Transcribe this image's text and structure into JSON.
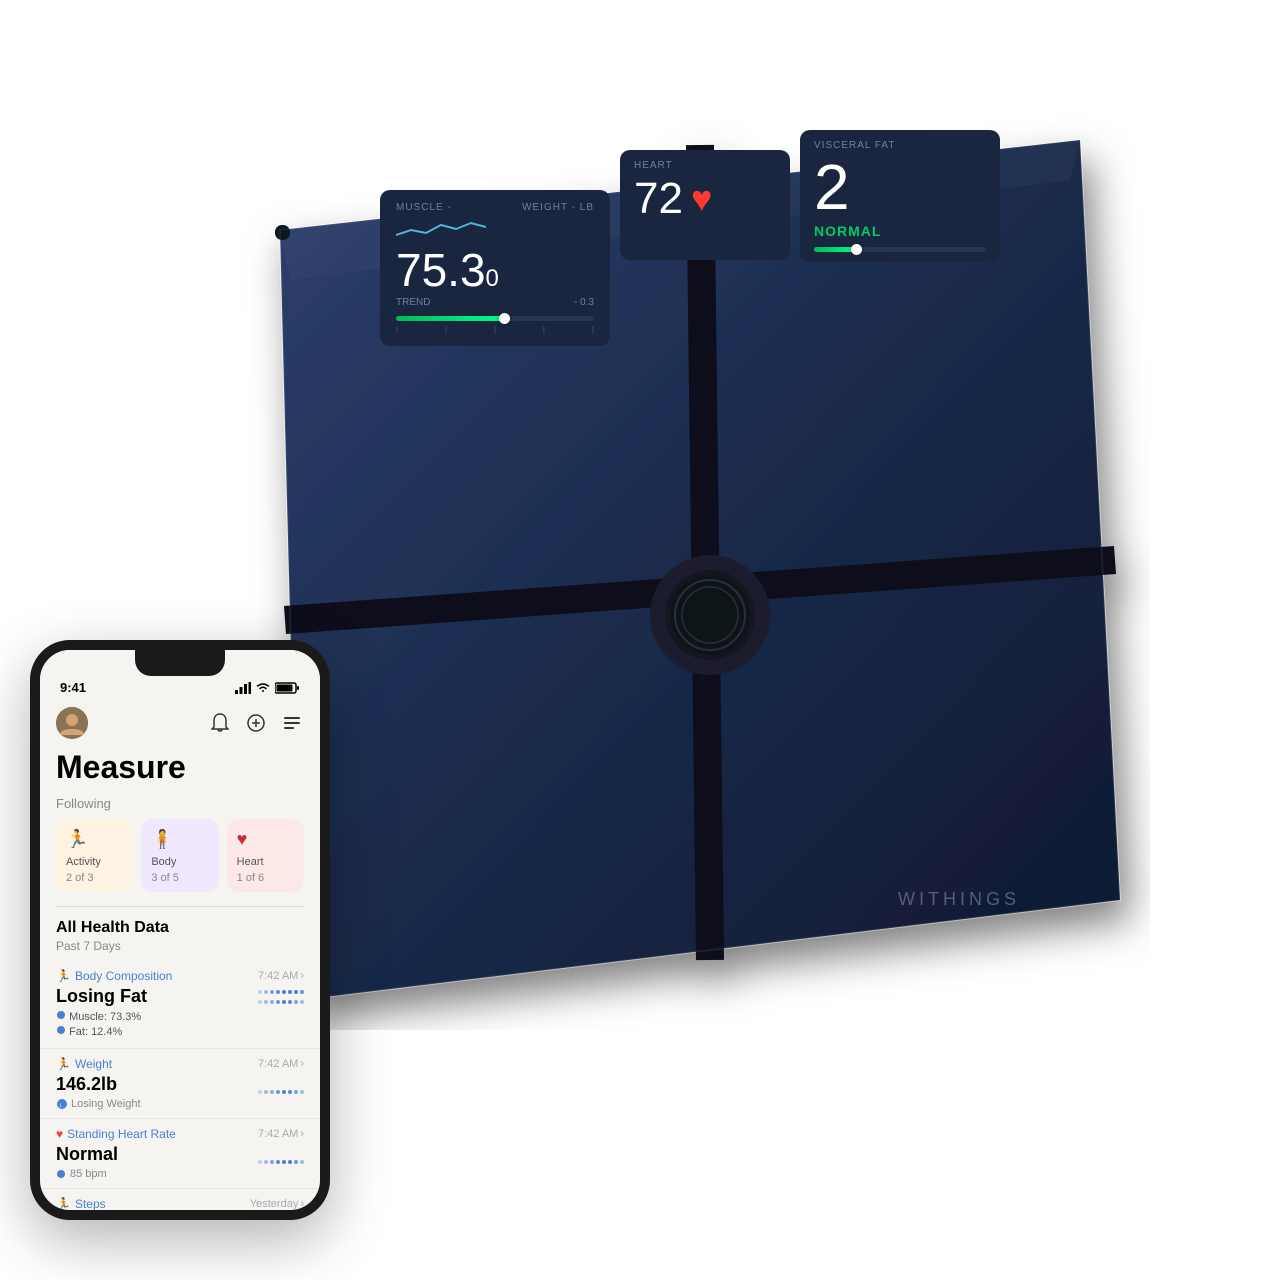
{
  "scale": {
    "brand": "WITHINGS",
    "cards": {
      "weight": {
        "label": "WEIGHT - LB",
        "muscle_label": "MUSCLE -",
        "value": "75.3",
        "value_decimal": "0",
        "trend_label": "TREND",
        "trend_value": "- 0.3",
        "progress_percent": 55
      },
      "heart": {
        "label": "HEART",
        "value": "72"
      },
      "visceral_fat": {
        "label": "VISCERAL FAT",
        "value": "2",
        "status": "NORMAL",
        "progress_percent": 25
      }
    }
  },
  "phone": {
    "status_bar": {
      "time": "9:41",
      "signal": "●●●",
      "wifi": "WiFi",
      "battery": "Battery"
    },
    "header": {
      "title": "Measure"
    },
    "following": {
      "label": "Following",
      "cards": [
        {
          "id": "activity",
          "name": "Activity",
          "count": "2 of 3",
          "icon": "🏃",
          "bg_class": "following-card-activity"
        },
        {
          "id": "body",
          "name": "Body",
          "count": "3 of 5",
          "icon": "🧍",
          "bg_class": "following-card-body"
        },
        {
          "id": "heart",
          "name": "Heart",
          "count": "1 of 6",
          "icon": "♥",
          "bg_class": "following-card-heart"
        }
      ]
    },
    "all_health": {
      "title": "All Health Data",
      "subtitle": "Past 7 Days",
      "items": [
        {
          "category": "Body Composition",
          "time": "7:42 AM",
          "title": "Losing Fat",
          "details": [
            "Muscle: 73.3%",
            "Fat: 12.4%"
          ]
        },
        {
          "category": "Weight",
          "time": "7:42 AM",
          "title": "146.2lb",
          "details": [
            "Losing Weight"
          ]
        },
        {
          "category": "Standing Heart Rate",
          "time": "7:42 AM",
          "title": "Normal",
          "details": [
            "85 bpm"
          ]
        },
        {
          "category": "Steps",
          "time": "Yesterday",
          "title": "",
          "details": []
        }
      ]
    }
  }
}
